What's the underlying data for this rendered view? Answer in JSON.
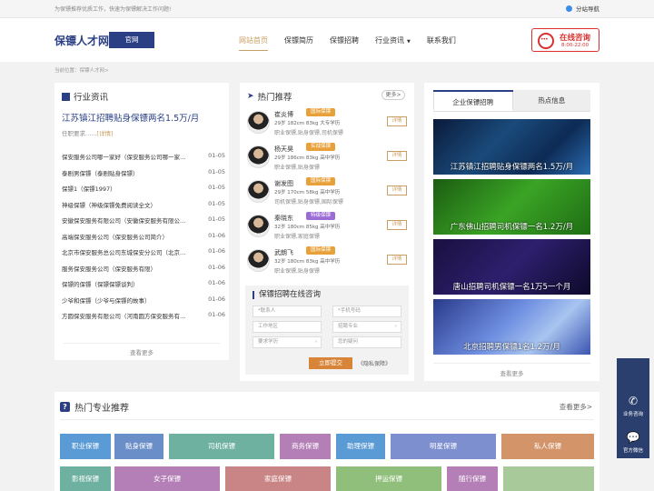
{
  "topbar": {
    "slogan": "为保镖推荐优质工作，快速为保镖解决工作问题!",
    "site_nav": "分站导航"
  },
  "header": {
    "logo": "保镖人才网",
    "badge": "官网"
  },
  "nav": [
    {
      "label": "网站首页",
      "active": true
    },
    {
      "label": "保镖简历",
      "active": false
    },
    {
      "label": "保镖招聘",
      "active": false
    },
    {
      "label": "行业资讯",
      "active": false,
      "caret": "▼"
    },
    {
      "label": "联系我们",
      "active": false
    }
  ],
  "consult": {
    "title": "在线咨询",
    "hours": "8:00-22:00"
  },
  "breadcrumb": "当前位置：保镖人才网>",
  "news": {
    "title": "行业资讯",
    "feature_title": "江苏镇江招聘贴身保镖两名1.5万/月",
    "feature_desc": "任职要求......",
    "feature_link": "[详情]",
    "items": [
      {
        "t": "保安服务公司哪一家好（保安服务公司哪一家…",
        "d": "01-05"
      },
      {
        "t": "泰剧男保镖（泰剧贴身保镖）",
        "d": "01-05"
      },
      {
        "t": "保镖1（保镖1997）",
        "d": "01-05"
      },
      {
        "t": "神级保镖（神级保镖免费阅读全文）",
        "d": "01-05"
      },
      {
        "t": "安徽保安服务有限公司（安徽保安服务有限公…",
        "d": "01-05"
      },
      {
        "t": "高端保安服务公司（保安服务公司简介）",
        "d": "01-06"
      },
      {
        "t": "北京市保安服务总公司东城保安分公司（北京…",
        "d": "01-06"
      },
      {
        "t": "服务保安服务公司（保安服务有限）",
        "d": "01-06"
      },
      {
        "t": "保镖的保镖（保镖保镖谈判）",
        "d": "01-06"
      },
      {
        "t": "少爷和保镖（少爷与保镖的故事）",
        "d": "01-06"
      },
      {
        "t": "方圆保安服务有限公司（河南圆方保安服务有…",
        "d": "01-06"
      }
    ],
    "more": "查看更多"
  },
  "hot": {
    "title": "热门推荐",
    "more": "更多>",
    "people": [
      {
        "name": "崔炎博",
        "badge": "国际保镖",
        "info": "29岁 182cm 83kg 大专学历",
        "tags": "职业保镖,贴身保镖,司机保镖",
        "detail": "详情",
        "color": "#e8a13a"
      },
      {
        "name": "杨天昊",
        "badge": "实战保镖",
        "info": "29岁 186cm 83kg 高中学历",
        "tags": "职业保镖,贴身保镖",
        "detail": "详情",
        "color": "#e8a13a"
      },
      {
        "name": "谢发图",
        "badge": "国际保镖",
        "info": "29岁 170cm 58kg 高中学历",
        "tags": "司机保镖,贴身保镖,国际保镖",
        "detail": "详情",
        "color": "#e8a13a"
      },
      {
        "name": "秦晓东",
        "badge": "特级保镖",
        "info": "32岁 180cm 85kg 高中学历",
        "tags": "职业保镖,家庭保镖",
        "detail": "详情",
        "color": "#9b6cd6"
      },
      {
        "name": "武朗飞",
        "badge": "国际保镖",
        "info": "32岁 180cm 83kg 高中学历",
        "tags": "职业保镖,贴身保镖",
        "detail": "详情",
        "color": "#e8a13a"
      }
    ],
    "form": {
      "title": "保镖招聘在线咨询",
      "fields": [
        "*联系人",
        "*手机号码",
        "工作地区",
        "招聘专业",
        "要求学历",
        "您的疑问"
      ],
      "submit": "立即提交",
      "privacy": "《隐私保障》"
    }
  },
  "jobs": {
    "tabs": [
      "企业保镖招聘",
      "热点信息"
    ],
    "banners": [
      "江苏镇江招聘贴身保镖两名1.5万/月",
      "广东佛山招聘司机保镖一名1.2万/月",
      "唐山招聘司机保镖一名1万5一个月",
      "北京招聘男保镖1名1.2万/月"
    ],
    "more": "查看更多"
  },
  "pro": {
    "title": "热门专业推荐",
    "more": "查看更多>",
    "tags": [
      {
        "label": "职业保镖",
        "color": "#5b9bd5"
      },
      {
        "label": "贴身保镖",
        "color": "#6a8fc8"
      },
      {
        "label": "司机保镖",
        "color": "#6fb1a0"
      },
      {
        "label": "商务保镖",
        "color": "#b47fb6"
      },
      {
        "label": "助理保镖",
        "color": "#5b9bd5"
      },
      {
        "label": "明星保镖",
        "color": "#7d8fcf"
      },
      {
        "label": "私人保镖",
        "color": "#d4946a"
      },
      {
        "label": "影视保镖",
        "color": "#6fb1a0"
      },
      {
        "label": "女子保镖",
        "color": "#b47fb6"
      },
      {
        "label": "家庭保镖",
        "color": "#c98585"
      },
      {
        "label": "押运保镖",
        "color": "#8fbf7a"
      },
      {
        "label": "随行保镖",
        "color": "#b47fb6"
      },
      {
        "label": "",
        "color": "#a8c99a"
      }
    ]
  },
  "sidebar": {
    "phone": "业务咨询",
    "wechat": "官方微信"
  }
}
